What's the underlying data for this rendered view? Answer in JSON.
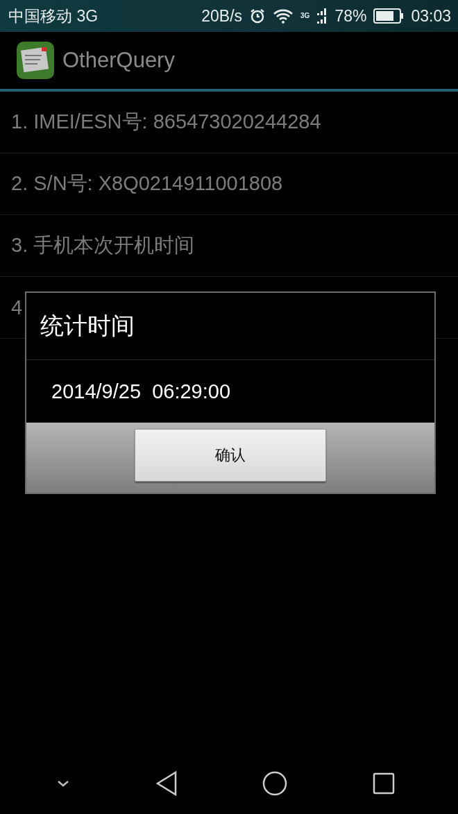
{
  "status_bar": {
    "carrier": "中国移动 3G",
    "speed": "20B/s",
    "network": "3G",
    "battery": "78%",
    "time": "03:03"
  },
  "app_bar": {
    "title": "OtherQuery"
  },
  "items": [
    {
      "label": "1. IMEI/ESN号: 865473020244284"
    },
    {
      "label": "2. S/N号: X8Q0214911001808"
    },
    {
      "label": "3. 手机本次开机时间"
    },
    {
      "label": "4"
    }
  ],
  "dialog": {
    "title": "统计时间",
    "message": "2014/9/25  06:29:00",
    "button": "确认"
  }
}
